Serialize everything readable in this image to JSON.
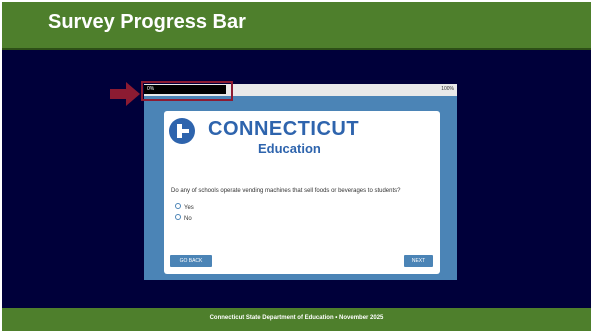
{
  "slide": {
    "title": "Survey Progress Bar",
    "footer": "Connecticut State Department of Education • November 2025"
  },
  "survey": {
    "progress": {
      "left_label": "0%",
      "right_label": "100%",
      "value_percent": 0
    },
    "logo": {
      "wordmark": "CONNECTICUT",
      "subtitle": "Education"
    },
    "question": "Do any of schools operate vending machines that sell foods or beverages to students?",
    "options": [
      "Yes",
      "No"
    ],
    "buttons": {
      "back": "GO BACK",
      "next": "NEXT"
    }
  },
  "colors": {
    "header_green": "#4e7f2c",
    "slide_navy": "#00003a",
    "survey_blue": "#4b84b6",
    "logo_blue": "#2e64ad",
    "callout_maroon": "#8c1b32"
  },
  "icons": {
    "callout": "right-arrow-icon",
    "logo": "connecticut-c-logo-icon"
  }
}
